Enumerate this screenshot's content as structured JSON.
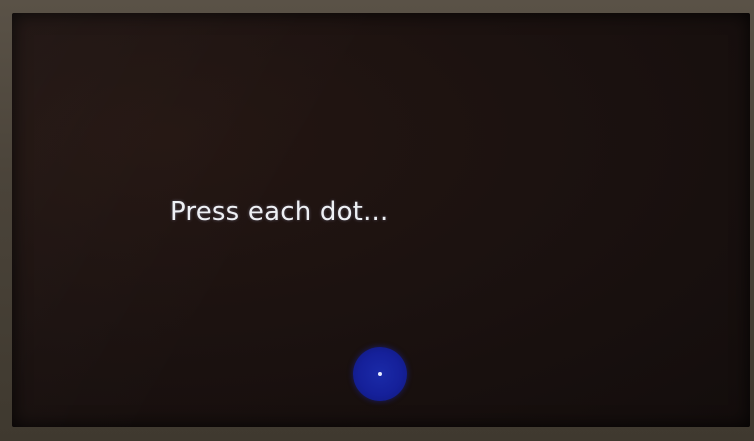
{
  "calibration": {
    "prompt_text": "Press each dot..."
  },
  "colors": {
    "screen_background": "#1c1210",
    "bezel": "#4b443a",
    "dot": "#15209a",
    "dot_center": "#e8ecff",
    "text": "#eef0f4"
  }
}
